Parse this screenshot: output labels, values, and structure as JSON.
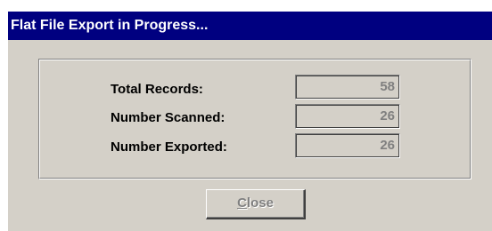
{
  "window": {
    "title": "Flat File Export in Progress..."
  },
  "stats": {
    "rows": [
      {
        "label": "Total Records:",
        "value": "58"
      },
      {
        "label": "Number Scanned:",
        "value": "26"
      },
      {
        "label": "Number Exported:",
        "value": "26"
      }
    ]
  },
  "actions": {
    "close_mnemonic": "C",
    "close_rest": "lose",
    "close_enabled": false
  },
  "colors": {
    "titlebar": "#000080",
    "face": "#d4d0c8",
    "disabled_text": "#808080"
  }
}
